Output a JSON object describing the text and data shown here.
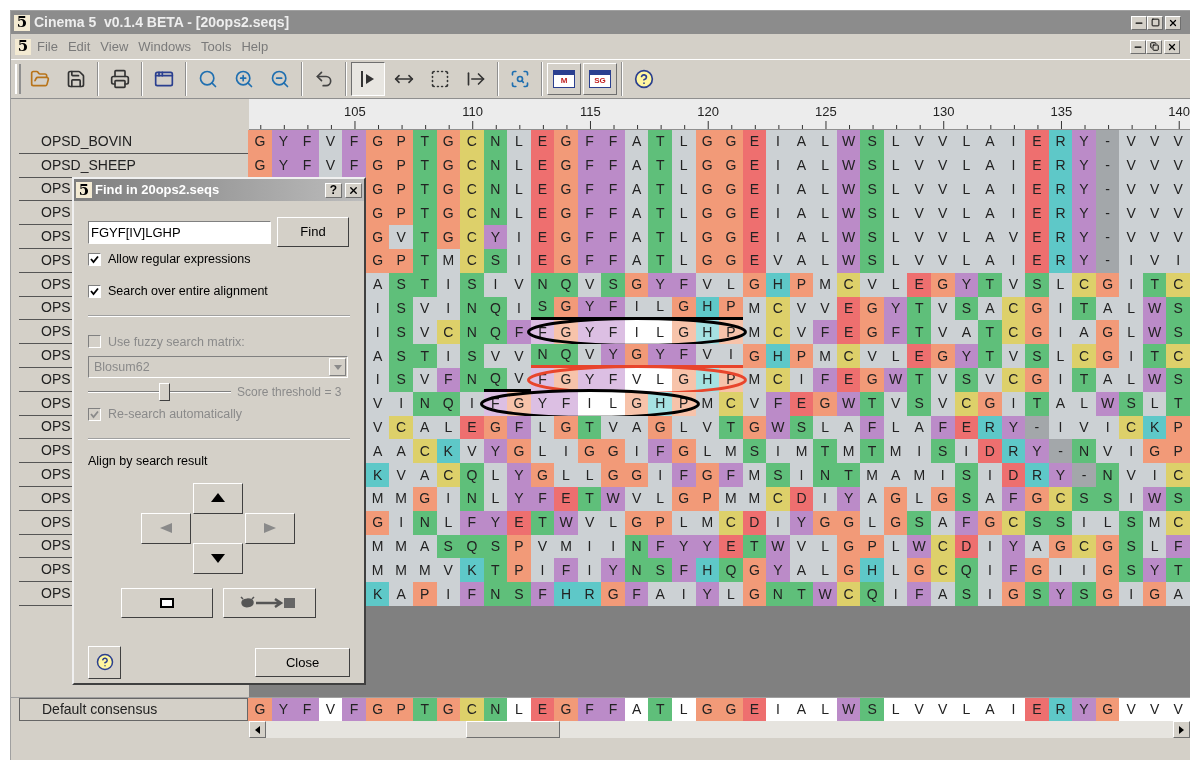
{
  "window": {
    "logo": "5",
    "title": "Cinema 5  v0.1.4 BETA - [20ops2.seqs]"
  },
  "menu": {
    "logo": "5",
    "items": [
      "File",
      "Edit",
      "View",
      "Windows",
      "Tools",
      "Help"
    ]
  },
  "toolbar": [
    {
      "kind": "open",
      "pressed": false
    },
    {
      "kind": "save",
      "pressed": false
    },
    {
      "kind": "separator"
    },
    {
      "kind": "print",
      "pressed": false
    },
    {
      "kind": "separator"
    },
    {
      "kind": "new-window",
      "pressed": false
    },
    {
      "kind": "separator"
    },
    {
      "kind": "zoom",
      "pressed": false
    },
    {
      "kind": "zoom-in",
      "pressed": false
    },
    {
      "kind": "zoom-out",
      "pressed": false
    },
    {
      "kind": "separator"
    },
    {
      "kind": "undo",
      "pressed": false
    },
    {
      "kind": "separator"
    },
    {
      "kind": "insert-mode",
      "pressed": true
    },
    {
      "kind": "move",
      "pressed": false
    },
    {
      "kind": "select-box",
      "pressed": false
    },
    {
      "kind": "shift-right",
      "pressed": false
    },
    {
      "kind": "separator"
    },
    {
      "kind": "find",
      "pressed": false
    },
    {
      "kind": "separator"
    },
    {
      "kind": "panel",
      "label": "M",
      "pressed": false
    },
    {
      "kind": "panel",
      "label": "SG",
      "pressed": false
    },
    {
      "kind": "separator"
    },
    {
      "kind": "help",
      "pressed": false
    }
  ],
  "ruler": [
    "105",
    "110",
    "115",
    "120",
    "125",
    "130",
    "135",
    "140"
  ],
  "rows": [
    {
      "name": "OPSD_BOVIN",
      "residues": [
        "G",
        "Y",
        "F",
        "V",
        "F",
        "G",
        "P",
        "T",
        "G",
        "C",
        "N",
        "L",
        "E",
        "G",
        "F",
        "F",
        "A",
        "T",
        "L",
        "G",
        "G",
        "E",
        "I",
        "A",
        "L",
        "W",
        "S",
        "L",
        "V",
        "V",
        "L",
        "A",
        "I",
        "E",
        "R",
        "Y",
        "-",
        "V",
        "V",
        "V"
      ]
    },
    {
      "name": "OPSD_SHEEP",
      "residues": [
        "G",
        "Y",
        "F",
        "V",
        "F",
        "G",
        "P",
        "T",
        "G",
        "C",
        "N",
        "L",
        "E",
        "G",
        "F",
        "F",
        "A",
        "T",
        "L",
        "G",
        "G",
        "E",
        "I",
        "A",
        "L",
        "W",
        "S",
        "L",
        "V",
        "V",
        "L",
        "A",
        "I",
        "E",
        "R",
        "Y",
        "-",
        "V",
        "V",
        "V"
      ]
    },
    {
      "name": "OPS",
      "residues": [
        "G",
        "P",
        "T",
        "G",
        "C",
        "N",
        "L",
        "E",
        "G",
        "F",
        "F",
        "A",
        "T",
        "L",
        "G",
        "G",
        "E",
        "I",
        "A",
        "L",
        "W",
        "S",
        "L",
        "V",
        "V",
        "L",
        "A",
        "I",
        "E",
        "R",
        "Y",
        "-",
        "V",
        "V",
        "V"
      ]
    },
    {
      "name": "OPS",
      "residues": [
        "G",
        "P",
        "T",
        "G",
        "C",
        "N",
        "L",
        "E",
        "G",
        "F",
        "F",
        "A",
        "T",
        "L",
        "G",
        "G",
        "E",
        "I",
        "A",
        "L",
        "W",
        "S",
        "L",
        "V",
        "V",
        "L",
        "A",
        "I",
        "E",
        "R",
        "Y",
        "-",
        "V",
        "V",
        "V"
      ]
    },
    {
      "name": "OPS",
      "residues": [
        "G",
        "V",
        "T",
        "G",
        "C",
        "Y",
        "I",
        "E",
        "G",
        "F",
        "F",
        "A",
        "T",
        "L",
        "G",
        "G",
        "E",
        "I",
        "A",
        "L",
        "W",
        "S",
        "L",
        "V",
        "V",
        "L",
        "A",
        "V",
        "E",
        "R",
        "Y",
        "-",
        "V",
        "V",
        "V"
      ]
    },
    {
      "name": "OPS",
      "residues": [
        "G",
        "P",
        "T",
        "M",
        "C",
        "S",
        "I",
        "E",
        "G",
        "F",
        "F",
        "A",
        "T",
        "L",
        "G",
        "G",
        "E",
        "V",
        "A",
        "L",
        "W",
        "S",
        "L",
        "V",
        "V",
        "L",
        "A",
        "I",
        "E",
        "R",
        "Y",
        "-",
        "I",
        "V",
        "I"
      ]
    },
    {
      "name": "OPS",
      "residues": [
        "A",
        "S",
        "T",
        "I",
        "S",
        "I",
        "V",
        "N",
        "Q",
        "V",
        "S",
        "G",
        "Y",
        "F",
        "V",
        "L",
        "G",
        "H",
        "P",
        "M",
        "C",
        "V",
        "L",
        "E",
        "G",
        "Y",
        "T",
        "V",
        "S",
        "L",
        "C",
        "G",
        "I",
        "T",
        "C"
      ]
    },
    {
      "name": "OPS",
      "underline": {
        "color": "#000000"
      },
      "residues": [
        "I",
        "S",
        "V",
        "I",
        "N",
        "Q",
        "I",
        {
          "residue": "S",
          "underlined": true
        },
        {
          "residue": "G",
          "underlined": true
        },
        {
          "residue": "Y",
          "underlined": true
        },
        {
          "residue": "F",
          "underlined": true
        },
        {
          "residue": "I",
          "underlined": true
        },
        {
          "residue": "L",
          "underlined": true
        },
        {
          "residue": "G",
          "underlined": true
        },
        {
          "residue": "H",
          "underlined": true
        },
        {
          "residue": "P",
          "underlined": true
        },
        "M",
        "C",
        "V",
        "V",
        "E",
        "G",
        "Y",
        "T",
        "V",
        "S",
        "A",
        "C",
        "G",
        "I",
        "T",
        "A",
        "L",
        "W",
        "S"
      ]
    },
    {
      "name": "OPS",
      "ring": {
        "color": "#000000"
      },
      "residues": [
        "I",
        "S",
        "V",
        "C",
        "N",
        "Q",
        "F",
        {
          "residue": "F",
          "matched": true
        },
        {
          "residue": "G",
          "matched": true
        },
        {
          "residue": "Y",
          "matched": true
        },
        {
          "residue": "F",
          "matched": true
        },
        {
          "residue": "I",
          "matched": true
        },
        {
          "residue": "L",
          "matched": true
        },
        {
          "residue": "G",
          "matched": true
        },
        {
          "residue": "H",
          "matched": true
        },
        {
          "residue": "P",
          "matched": true
        },
        "M",
        "C",
        "V",
        "F",
        "E",
        "G",
        "F",
        "T",
        "V",
        "A",
        "T",
        "C",
        "G",
        "I",
        "A",
        "G",
        "L",
        "W",
        "S"
      ]
    },
    {
      "name": "OPS",
      "underline": {
        "color": "#e8452c"
      },
      "residues": [
        "A",
        "S",
        "T",
        "I",
        "S",
        "V",
        "V",
        {
          "residue": "N",
          "underlined": true
        },
        {
          "residue": "Q",
          "underlined": true
        },
        {
          "residue": "V",
          "underlined": true
        },
        {
          "residue": "Y",
          "underlined": true
        },
        {
          "residue": "G",
          "underlined": true
        },
        {
          "residue": "Y",
          "underlined": true
        },
        {
          "residue": "F",
          "underlined": true
        },
        {
          "residue": "V",
          "underlined": true
        },
        {
          "residue": "I",
          "underlined": true
        },
        "G",
        "H",
        "P",
        "M",
        "C",
        "V",
        "L",
        "E",
        "G",
        "Y",
        "T",
        "V",
        "S",
        "L",
        "C",
        "G",
        "I",
        "T",
        "C"
      ]
    },
    {
      "name": "OPS",
      "ring": {
        "color": "#e8452c"
      },
      "underline": {
        "color": "#000000"
      },
      "residues": [
        "I",
        "S",
        "V",
        "F",
        "N",
        {
          "residue": "Q",
          "underlined": true
        },
        {
          "residue": "V",
          "underlined": true
        },
        {
          "residue": "F",
          "matched": true
        },
        {
          "residue": "G",
          "matched": true
        },
        {
          "residue": "Y",
          "matched": true
        },
        {
          "residue": "F",
          "matched": true
        },
        {
          "residue": "V",
          "matched": true
        },
        {
          "residue": "L",
          "matched": true
        },
        {
          "residue": "G",
          "matched": true
        },
        {
          "residue": "H",
          "matched": true
        },
        {
          "residue": "P",
          "matched": true
        },
        "M",
        "C",
        "I",
        "F",
        "E",
        "G",
        "W",
        "T",
        "V",
        "S",
        "V",
        "C",
        "G",
        "I",
        "T",
        "A",
        "L",
        "W",
        "S"
      ]
    },
    {
      "name": "OPS",
      "ring": {
        "color": "#000000"
      },
      "residues": [
        "V",
        "I",
        "N",
        "Q",
        "I",
        {
          "residue": "F",
          "matched": true
        },
        {
          "residue": "G",
          "matched": true
        },
        {
          "residue": "Y",
          "matched": true
        },
        {
          "residue": "F",
          "matched": true
        },
        {
          "residue": "I",
          "matched": true
        },
        {
          "residue": "L",
          "matched": true
        },
        {
          "residue": "G",
          "matched": true
        },
        {
          "residue": "H",
          "matched": true
        },
        {
          "residue": "P",
          "matched": true
        },
        "M",
        "C",
        "V",
        "F",
        "E",
        "G",
        "W",
        "T",
        "V",
        "S",
        "V",
        "C",
        "G",
        "I",
        "T",
        "A",
        "L",
        "W",
        "S",
        "L",
        "T"
      ]
    },
    {
      "name": "OPS",
      "residues": [
        "V",
        "C",
        "A",
        "L",
        "E",
        "G",
        "F",
        "L",
        "G",
        "T",
        "V",
        "A",
        "G",
        "L",
        "V",
        "T",
        "G",
        "W",
        "S",
        "L",
        "A",
        "F",
        "L",
        "A",
        "F",
        "E",
        "R",
        "Y",
        "-",
        "I",
        "V",
        "I",
        "C",
        "K",
        "P"
      ]
    },
    {
      "name": "OPS",
      "residues": [
        "A",
        "A",
        "C",
        "K",
        "V",
        "Y",
        "G",
        "L",
        "I",
        "G",
        "G",
        "I",
        "F",
        "G",
        "L",
        "M",
        "S",
        "I",
        "M",
        "T",
        "M",
        "T",
        "M",
        "I",
        "S",
        "I",
        "D",
        "R",
        "Y",
        "-",
        "N",
        "V",
        "I",
        "G",
        "P"
      ]
    },
    {
      "name": "OPS",
      "residues": [
        "K",
        "V",
        "A",
        "C",
        "Q",
        "L",
        "Y",
        "G",
        "L",
        "L",
        "G",
        "G",
        "I",
        "F",
        "G",
        "F",
        "M",
        "S",
        "I",
        "N",
        "T",
        "M",
        "A",
        "M",
        "I",
        "S",
        "I",
        "D",
        "R",
        "Y",
        "-",
        "N",
        "V",
        "I",
        "C"
      ]
    },
    {
      "name": "OPS",
      "residues": [
        "M",
        "M",
        "G",
        "I",
        "N",
        "L",
        "Y",
        "F",
        "E",
        "T",
        "W",
        "V",
        "L",
        "G",
        "P",
        "M",
        "M",
        "C",
        "D",
        "I",
        "Y",
        "A",
        "G",
        "L",
        "G",
        "S",
        "A",
        "F",
        "G",
        "C",
        "S",
        "S",
        "I",
        "W",
        "S"
      ]
    },
    {
      "name": "OPS",
      "residues": [
        "G",
        "I",
        "N",
        "L",
        "F",
        "Y",
        "E",
        "T",
        "W",
        "V",
        "L",
        "G",
        "P",
        "L",
        "M",
        "C",
        "D",
        "I",
        "Y",
        "G",
        "G",
        "L",
        "G",
        "S",
        "A",
        "F",
        "G",
        "C",
        "S",
        "S",
        "I",
        "L",
        "S",
        "M",
        "C"
      ]
    },
    {
      "name": "OPS",
      "residues": [
        "M",
        "M",
        "A",
        "S",
        "Q",
        "S",
        "P",
        "V",
        "M",
        "I",
        "I",
        "N",
        "F",
        "Y",
        "Y",
        "E",
        "T",
        "W",
        "V",
        "L",
        "G",
        "P",
        "L",
        "W",
        "C",
        "D",
        "I",
        "Y",
        "A",
        "G",
        "C",
        "G",
        "S",
        "L",
        "F"
      ]
    },
    {
      "name": "OPS",
      "residues": [
        "M",
        "M",
        "M",
        "V",
        "K",
        "T",
        "P",
        "I",
        "F",
        "I",
        "Y",
        "N",
        "S",
        "F",
        "H",
        "Q",
        "G",
        "Y",
        "A",
        "L",
        "G",
        "H",
        "L",
        "G",
        "C",
        "Q",
        "I",
        "F",
        "G",
        "I",
        "I",
        "G",
        "S",
        "Y",
        "T"
      ]
    },
    {
      "name": "OPS",
      "residues": [
        "K",
        "A",
        "P",
        "I",
        "F",
        "N",
        "S",
        "F",
        "H",
        "R",
        "G",
        "F",
        "A",
        "I",
        "Y",
        "L",
        "G",
        "N",
        "T",
        "W",
        "C",
        "Q",
        "I",
        "F",
        "A",
        "S",
        "I",
        "G",
        "S",
        "Y",
        "S",
        "G",
        "I",
        "G",
        "A"
      ]
    }
  ],
  "consensus": {
    "name": "Default consensus",
    "residues": [
      "G",
      "Y",
      "F",
      "V",
      "F",
      "G",
      "P",
      "T",
      "G",
      "C",
      "N",
      "L",
      "E",
      "G",
      "F",
      "F",
      "A",
      "T",
      "L",
      "G",
      "G",
      "E",
      "I",
      "A",
      "L",
      "W",
      "S",
      "L",
      "V",
      "V",
      "L",
      "A",
      "I",
      "E",
      "R",
      "Y",
      "G",
      "V",
      "V",
      "V"
    ]
  },
  "find_dialog": {
    "logo": "5",
    "title": "Find in 20ops2.seqs",
    "help": "?",
    "query": "FGYF[IV]LGHP",
    "find_button": "Find",
    "options": [
      {
        "label": "Allow regular expressions",
        "checked": true,
        "disabled": false
      },
      {
        "label": "Search over entire alignment",
        "checked": true,
        "disabled": false
      }
    ],
    "fuzzy": {
      "label": "Use fuzzy search matrix:",
      "checked": false,
      "disabled": true
    },
    "matrix": {
      "value": "Blosum62",
      "disabled": true
    },
    "threshold": {
      "level": 0.54,
      "label": "Score threshold = 3",
      "disabled": true
    },
    "research": {
      "label": "Re-search automatically",
      "checked": true,
      "disabled": true
    },
    "align_label": "Align by search result",
    "arrows": [
      {
        "kind": "up",
        "disabled": false
      },
      {
        "kind": "left",
        "disabled": true
      },
      {
        "kind": "right",
        "disabled": true
      },
      {
        "kind": "down",
        "disabled": false
      }
    ],
    "close_button": "Close"
  }
}
